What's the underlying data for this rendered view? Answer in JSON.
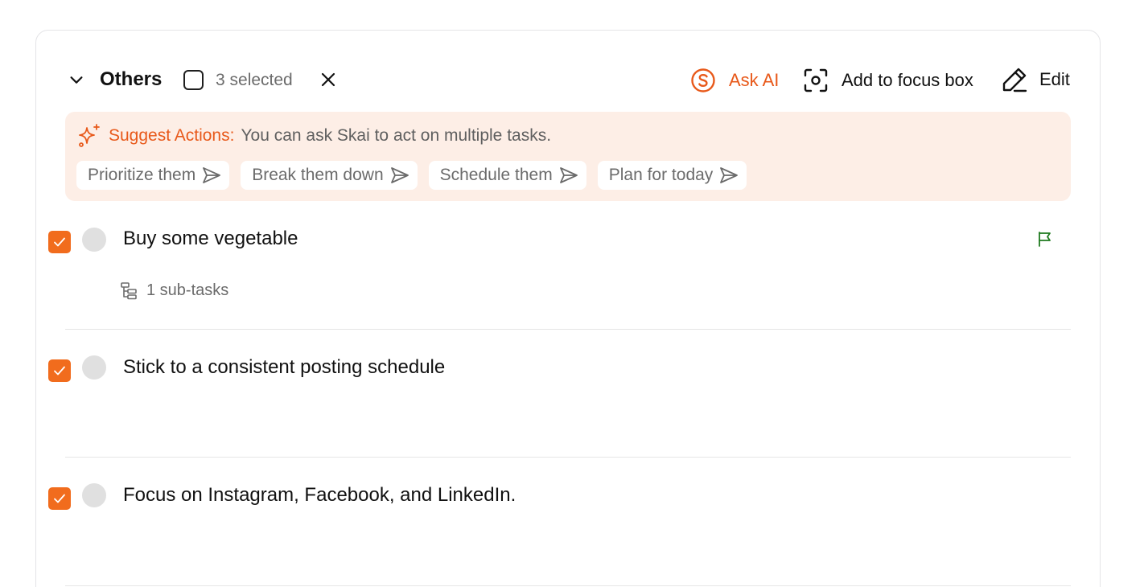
{
  "group": {
    "title": "Others",
    "selected_text": "3 selected"
  },
  "actions": {
    "ask_ai": "Ask AI",
    "add_focus": "Add to focus box",
    "edit": "Edit"
  },
  "suggest": {
    "title": "Suggest Actions:",
    "description": "You can ask Skai to act on multiple tasks.",
    "chips": [
      "Prioritize them",
      "Break them down",
      "Schedule them",
      "Plan for today"
    ]
  },
  "tasks": [
    {
      "title": "Buy some vegetable",
      "subtasks": "1 sub-tasks",
      "flag_color": "#1f7a1f",
      "checked": true
    },
    {
      "title": "Stick to a consistent posting schedule",
      "checked": true
    },
    {
      "title": "Focus on Instagram, Facebook, and LinkedIn.",
      "checked": true
    }
  ],
  "colors": {
    "accent": "#e8591a",
    "checkbox": "#f16c1d",
    "suggest_bg": "#fdeee6"
  }
}
